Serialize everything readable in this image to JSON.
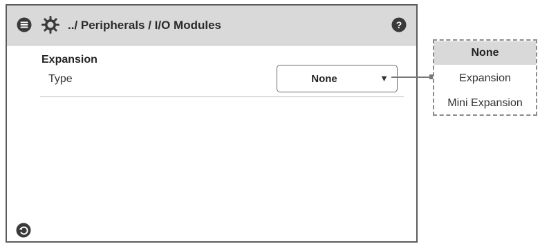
{
  "header": {
    "breadcrumb": "../ Peripherals / I/O Modules",
    "menu_icon": "menu-icon",
    "settings_icon": "gear-icon",
    "help_icon": "help-icon"
  },
  "main": {
    "section_title": "Expansion",
    "field_label": "Type",
    "select_value": "None",
    "select_arrow": "▼"
  },
  "footer": {
    "back_icon": "back-icon"
  },
  "dropdown": {
    "options": [
      "None",
      "Expansion",
      "Mini Expansion"
    ],
    "selected": "None"
  },
  "colors": {
    "header_bg": "#d9d9d9",
    "border": "#5b5b5b",
    "icon": "#3a3a3a",
    "selected_option_bg": "#d9d9d9"
  }
}
